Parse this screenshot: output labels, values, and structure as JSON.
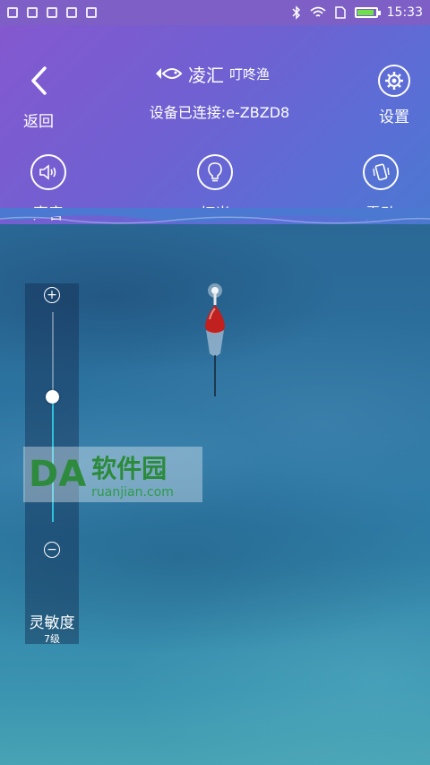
{
  "status_bar": {
    "time": "15:33",
    "icons": [
      "trash-icon",
      "shield-icon",
      "image-icon",
      "usb-icon",
      "grid-icon",
      "bluetooth-icon",
      "wifi-icon",
      "sim-icon",
      "battery-icon"
    ]
  },
  "header": {
    "back_label": "返回",
    "brand_name": "凌汇",
    "brand_sub": "叮咚渔",
    "device_status": "设备已连接:e-ZBZD8",
    "settings_label": "设置",
    "colors": {
      "gradient_start": "#8458cf",
      "gradient_end": "#4b78d0"
    }
  },
  "features": [
    {
      "label": "声音",
      "icon": "speaker-icon"
    },
    {
      "label": "灯光",
      "icon": "bulb-icon"
    },
    {
      "label": "震动",
      "icon": "vibrate-icon"
    }
  ],
  "sensitivity": {
    "title": "灵敏度",
    "level_text": "7级",
    "level_fraction": 0.6,
    "accent": "#30c0d8"
  },
  "watermark": {
    "logo": "DA",
    "title": "软件园",
    "site": "ruanjian.com"
  }
}
